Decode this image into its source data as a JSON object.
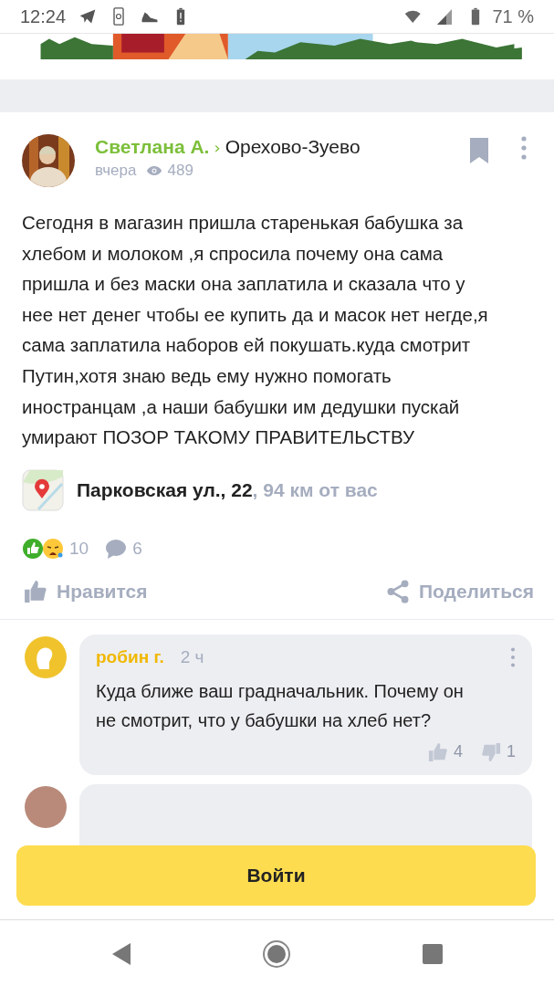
{
  "status_bar": {
    "time": "12:24",
    "battery": "71 %"
  },
  "post": {
    "author": "Светлана А.",
    "separator": "›",
    "location": "Орехово-Зуево",
    "time": "вчера",
    "views": "489",
    "text": "Сегодня в магазин пришла старенькая бабушка за хлебом и молоком ,я спросила почему она сама пришла и без маски она заплатила и сказала что у нее нет денег чтобы ее купить да и масок нет негде,я сама заплатила наборов ей покушать.куда смотрит Путин,хотя знаю ведь ему нужно помогать иностранцам ,а наши бабушки им дедушки пускай умирают ПОЗОР ТАКОМУ ПРАВИТЕЛЬСТВУ",
    "address": "Парковская ул., 22",
    "distance": ", 94 км от вас",
    "reactions_count": "10",
    "comments_count": "6",
    "actions": [
      {
        "kind": "like",
        "label": "Нравится"
      },
      {
        "kind": "share",
        "label": "Поделиться"
      }
    ]
  },
  "comments": [
    {
      "author": "робин г.",
      "time": "2 ч",
      "text": "Куда ближе ваш градначальник. Почему он не смотрит, что у бабушки на хлеб нет?",
      "likes": "4",
      "dislikes": "1"
    }
  ],
  "login_button": "Войти"
}
